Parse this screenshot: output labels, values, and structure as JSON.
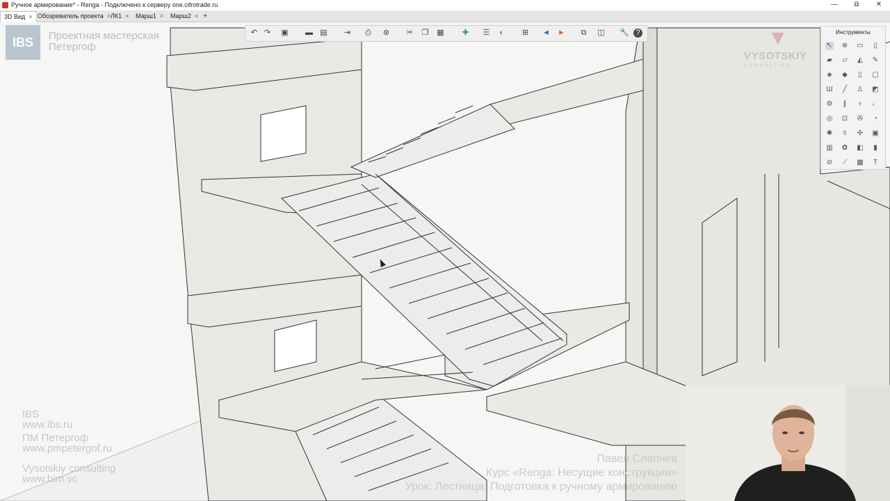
{
  "window": {
    "title": "Ручное армирование* - Renga - Подключено к серверу one.cifrotrade.ru",
    "controls": [
      "—",
      "⧉",
      "✕"
    ]
  },
  "tabs": [
    {
      "label": "3D Вид",
      "active": true
    },
    {
      "label": "Обозреватель проекта",
      "active": false
    },
    {
      "label": "ЛК1",
      "active": false
    },
    {
      "label": "Марш1",
      "active": false
    },
    {
      "label": "Марш2",
      "active": false
    }
  ],
  "add_tab": "+",
  "logo": {
    "text": "IBS",
    "studio_line1": "Проектная мастерская",
    "studio_line2": "Петергоф"
  },
  "toolbar": {
    "icons": [
      "undo-icon",
      "redo-icon",
      "view-cube-icon",
      "box-icon",
      "save-icon",
      "export-icon",
      "print-icon",
      "orbit-icon",
      "cut-icon",
      "copy-icon",
      "paste-icon",
      "add-icon",
      "list-icon",
      "paint-icon",
      "filter-icon",
      "level-icon",
      "arrow-icon",
      "layers-icon",
      "group-icon",
      "wrench-icon",
      "help-icon"
    ]
  },
  "tools_panel": {
    "header": "Инструменты"
  },
  "watermark": {
    "brand": "VYSOTSKIY",
    "brand_sub": "CONSULTING",
    "left_lines": [
      "IBS",
      "www.ibs.ru",
      "ПМ Петергоф",
      "www.pmpetergof.ru",
      "Vysotskiy consulting",
      "www.bim.vc"
    ],
    "right_lines": [
      "Павел Слепнев",
      "Курс «Renga: Несущие конструкции»",
      "Урок: Лестница. Подготовка к ручному армированию"
    ]
  },
  "colors": {
    "viewport_bg": "#f6f6f4",
    "model_fill": "#e9e9e6",
    "model_stroke": "#333333"
  }
}
